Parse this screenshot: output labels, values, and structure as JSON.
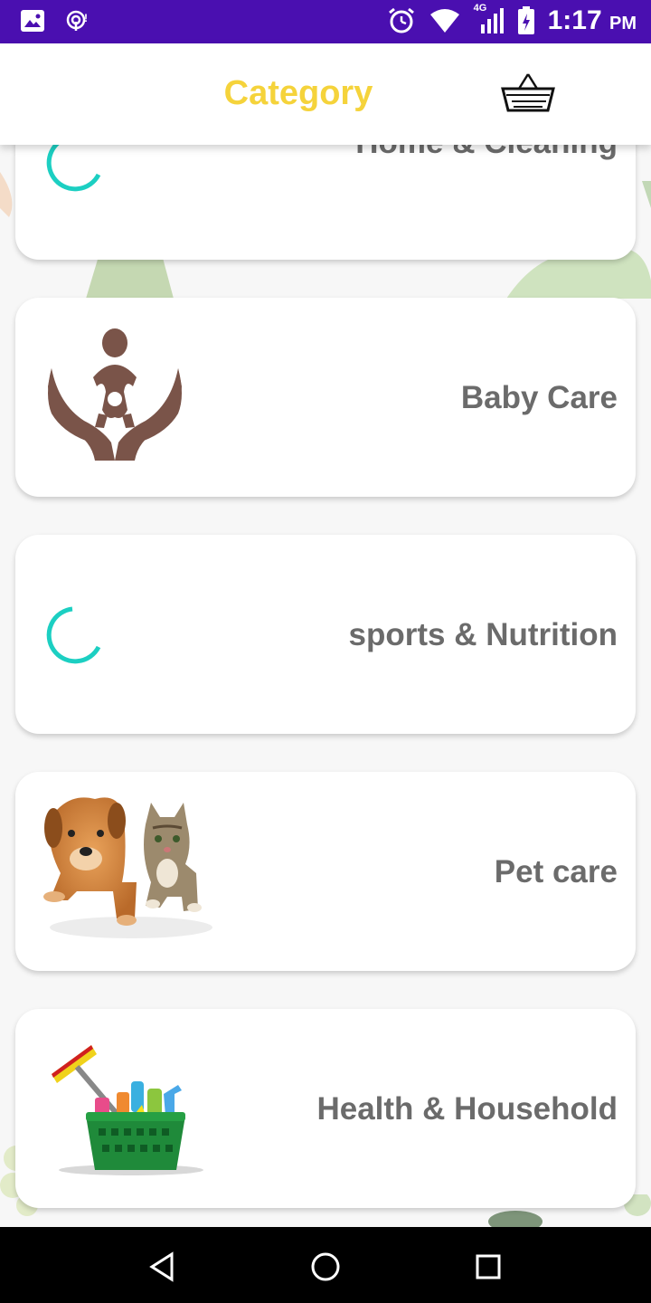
{
  "status_bar": {
    "time": "1:17",
    "ampm": "PM",
    "network": "4G",
    "icons": [
      "image-icon",
      "hotspot-icon",
      "alarm-icon",
      "wifi-icon",
      "signal-icon",
      "battery-icon"
    ]
  },
  "app_bar": {
    "title": "Category",
    "cart_icon": "shopping-basket-icon",
    "title_color": "#f5d33b"
  },
  "categories": [
    {
      "label": "Home & Cleaning",
      "image": "loading-spinner"
    },
    {
      "label": "Baby Care",
      "image": "baby-care-hands-icon"
    },
    {
      "label": "sports & Nutrition",
      "image": "loading-spinner"
    },
    {
      "label": "Pet care",
      "image": "dog-and-cat-photo"
    },
    {
      "label": "Health & Household",
      "image": "cleaning-basket-illustration"
    }
  ],
  "nav_bar": {
    "buttons": [
      "back-icon",
      "home-icon",
      "recents-icon"
    ]
  },
  "colors": {
    "status_bar": "#4a0fb0",
    "spinner": "#1ccfc2",
    "label_text": "#6b6b6b",
    "baby_icon": "#7a5449"
  }
}
